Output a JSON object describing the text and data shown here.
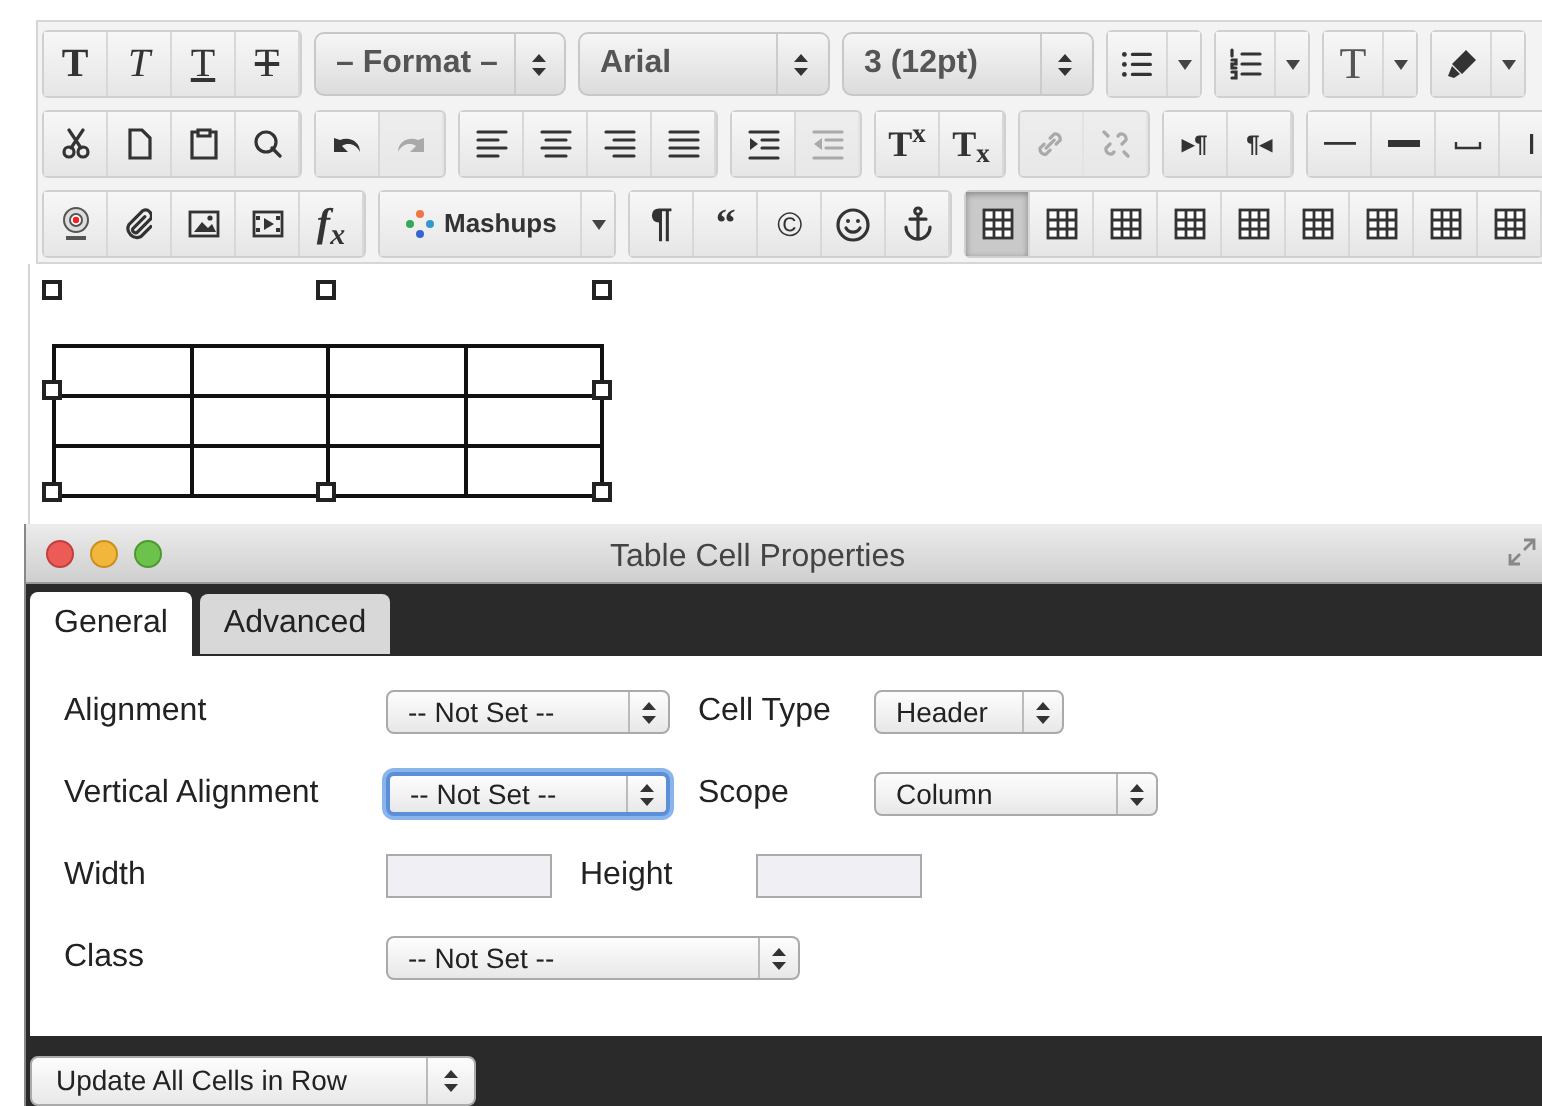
{
  "toolbar": {
    "selects": [
      "– Format –",
      "Arial",
      "3 (12pt)"
    ],
    "glyphs": [
      "T",
      "T",
      "T",
      "T",
      "T",
      "T$^{x}$",
      "T$_{x}$",
      "▸¶",
      "¶◂",
      "f$_{x}$",
      "¶",
      "“",
      "©"
    ],
    "mashups": "Mashups",
    "history": [
      {
        "disabled": false
      },
      {
        "disabled": true
      }
    ],
    "indent": [
      {
        "disabled": false
      },
      {
        "disabled": true
      }
    ],
    "link": [
      {
        "disabled": true
      },
      {
        "disabled": true
      }
    ],
    "table_tools": [
      {
        "selected": true
      },
      {
        "selected": false
      },
      {
        "selected": false
      },
      {
        "selected": false
      },
      {
        "selected": false
      },
      {
        "selected": false
      },
      {
        "selected": false
      },
      {
        "selected": false
      },
      {
        "selected": false
      }
    ]
  },
  "dialog": {
    "title": "Table Cell Properties",
    "tabs": [
      {
        "label": "General",
        "selected": true
      },
      {
        "label": "Advanced",
        "selected": false
      }
    ],
    "rows": [
      [
        {
          "label": "Alignment",
          "kind": "select",
          "value": "-- Not Set --",
          "focused": false
        },
        {
          "label": "Cell Type",
          "kind": "select",
          "value": "Header",
          "focused": false
        }
      ],
      [
        {
          "label": "Vertical Alignment",
          "kind": "select",
          "value": "-- Not Set --",
          "focused": true
        },
        {
          "label": "Scope",
          "kind": "select",
          "value": "Column",
          "focused": false
        }
      ],
      [
        {
          "label": "Width",
          "kind": "input",
          "focused": false
        },
        {
          "label": "Height",
          "kind": "input",
          "focused": false
        }
      ],
      [
        {
          "label": "Class",
          "kind": "select",
          "value": "-- Not Set --",
          "focused": false
        }
      ]
    ],
    "footer_select": "Update All Cells in Row"
  }
}
